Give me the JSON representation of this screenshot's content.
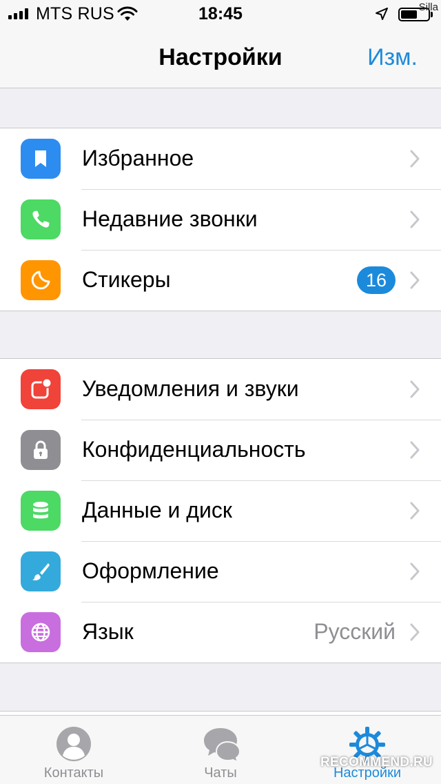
{
  "status_bar": {
    "carrier": "MTS RUS",
    "time": "18:45",
    "watermark": "Silla"
  },
  "nav": {
    "title": "Настройки",
    "edit_label": "Изм."
  },
  "groups": [
    {
      "items": [
        {
          "label": "Избранное",
          "icon": "bookmark-icon",
          "icon_color": "#2d8cf0"
        },
        {
          "label": "Недавние звонки",
          "icon": "phone-icon",
          "icon_color": "#4cd964"
        },
        {
          "label": "Стикеры",
          "icon": "sticker-icon",
          "icon_color": "#ff9500",
          "badge": "16"
        }
      ]
    },
    {
      "items": [
        {
          "label": "Уведомления и звуки",
          "icon": "notification-icon",
          "icon_color": "#f0433a"
        },
        {
          "label": "Конфиденциальность",
          "icon": "lock-icon",
          "icon_color": "#8e8e93"
        },
        {
          "label": "Данные и диск",
          "icon": "database-icon",
          "icon_color": "#4cd964"
        },
        {
          "label": "Оформление",
          "icon": "brush-icon",
          "icon_color": "#34aadc"
        },
        {
          "label": "Язык",
          "icon": "globe-icon",
          "icon_color": "#c86edf",
          "value": "Русский"
        }
      ]
    }
  ],
  "tabs": [
    {
      "label": "Контакты",
      "icon": "contacts-icon",
      "active": false
    },
    {
      "label": "Чаты",
      "icon": "chats-icon",
      "active": false
    },
    {
      "label": "Настройки",
      "icon": "settings-gear-icon",
      "active": true
    }
  ],
  "watermark_bottom": "RECOMMEND.RU",
  "colors": {
    "accent": "#1c8adb",
    "background": "#efeff4",
    "separator": "#c8c7cc"
  }
}
